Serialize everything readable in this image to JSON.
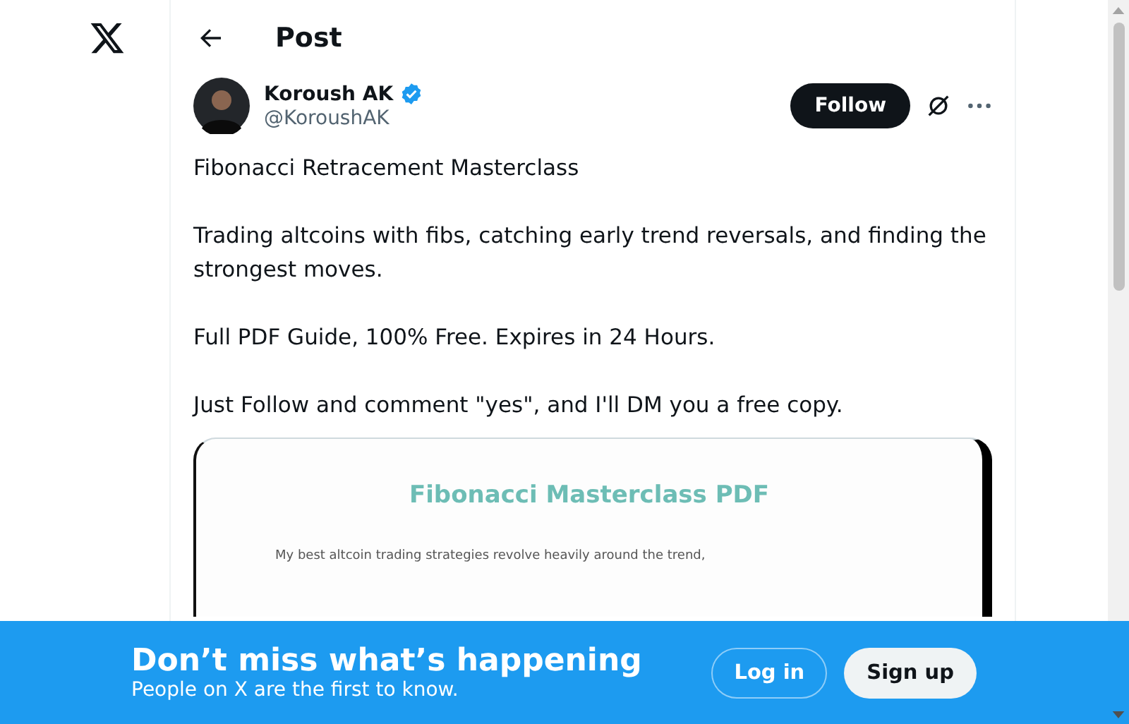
{
  "header": {
    "title": "Post"
  },
  "author": {
    "name": "Koroush AK",
    "handle": "@KoroushAK",
    "verified": true
  },
  "follow_button": "Follow",
  "post": {
    "paragraphs": [
      "Fibonacci Retracement Masterclass",
      "Trading altcoins with fibs, catching early trend reversals, and finding the strongest moves.",
      "Full PDF Guide, 100% Free. Expires in 24 Hours.",
      "Just Follow and comment \"yes\", and I'll DM you a free copy."
    ]
  },
  "document_image": {
    "title": "Fibonacci Masterclass PDF",
    "text": "My best altcoin trading strategies revolve heavily around the trend,"
  },
  "banner": {
    "headline": "Don’t miss what’s happening",
    "subtext": "People on X are the first to know.",
    "login": "Log in",
    "signup": "Sign up"
  }
}
